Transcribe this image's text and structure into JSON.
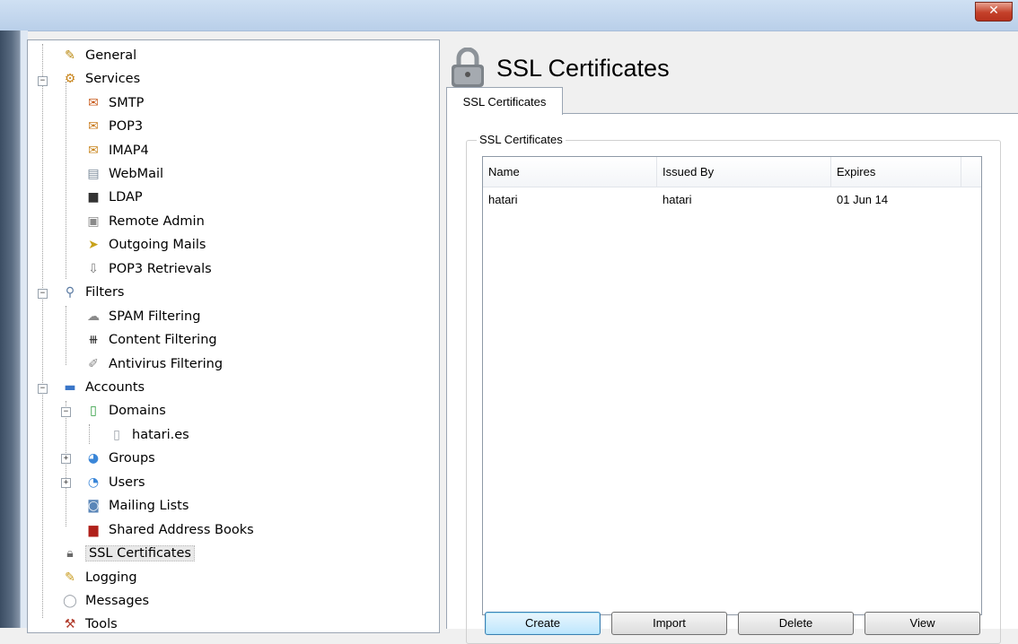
{
  "window": {
    "close_glyph": "✕"
  },
  "tree": {
    "items": [
      {
        "label": "General",
        "icon": "wrench-icon"
      },
      {
        "label": "Services",
        "icon": "services-icon"
      },
      {
        "label": "SMTP",
        "icon": "smtp-icon"
      },
      {
        "label": "POP3",
        "icon": "pop3-icon"
      },
      {
        "label": "IMAP4",
        "icon": "imap4-icon"
      },
      {
        "label": "WebMail",
        "icon": "webmail-icon"
      },
      {
        "label": "LDAP",
        "icon": "ldap-icon"
      },
      {
        "label": "Remote Admin",
        "icon": "remote-admin-icon"
      },
      {
        "label": "Outgoing Mails",
        "icon": "outgoing-mail-icon"
      },
      {
        "label": "POP3 Retrievals",
        "icon": "pop3-retrieval-icon"
      },
      {
        "label": "Filters",
        "icon": "filters-icon"
      },
      {
        "label": "SPAM Filtering",
        "icon": "spam-icon"
      },
      {
        "label": "Content Filtering",
        "icon": "content-filter-icon"
      },
      {
        "label": "Antivirus Filtering",
        "icon": "antivirus-icon"
      },
      {
        "label": "Accounts",
        "icon": "folder-icon"
      },
      {
        "label": "Domains",
        "icon": "domains-icon"
      },
      {
        "label": "hatari.es",
        "icon": "domain-icon"
      },
      {
        "label": "Groups",
        "icon": "groups-icon"
      },
      {
        "label": "Users",
        "icon": "users-icon"
      },
      {
        "label": "Mailing Lists",
        "icon": "mailing-lists-icon"
      },
      {
        "label": "Shared Address Books",
        "icon": "address-book-icon"
      },
      {
        "label": "SSL Certificates",
        "icon": "padlock-icon"
      },
      {
        "label": "Logging",
        "icon": "logging-icon"
      },
      {
        "label": "Messages",
        "icon": "messages-icon"
      },
      {
        "label": "Tools",
        "icon": "tools-icon"
      }
    ],
    "selected": "SSL Certificates"
  },
  "page": {
    "title": "SSL Certificates",
    "tab_label": "SSL Certificates",
    "group_label": "SSL Certificates"
  },
  "list": {
    "columns": [
      "Name",
      "Issued By",
      "Expires"
    ],
    "rows": [
      {
        "name": "hatari",
        "issued_by": "hatari",
        "expires": "01 Jun 14"
      }
    ]
  },
  "buttons": {
    "create": "Create",
    "import": "Import",
    "delete": "Delete",
    "view": "View"
  }
}
